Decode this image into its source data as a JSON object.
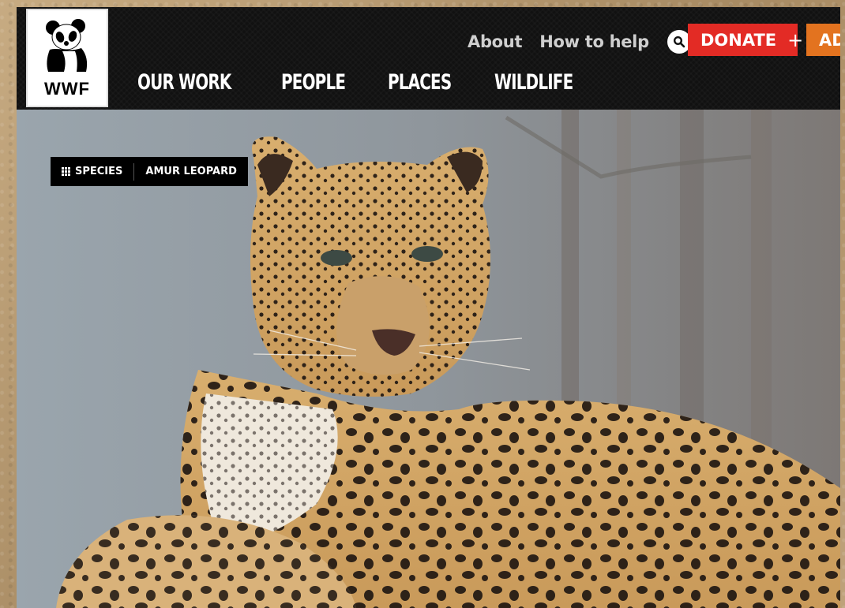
{
  "brand": {
    "logo_text": "WWF"
  },
  "header": {
    "top_links": [
      "About",
      "How to help"
    ],
    "donate_label": "DONATE",
    "donate_plus": "+",
    "adopt_label": "AD",
    "nav": [
      "OUR WORK",
      "PEOPLE",
      "PLACES",
      "WILDLIFE"
    ]
  },
  "breadcrumb": {
    "section": "SPECIES",
    "page": "AMUR LEOPARD"
  },
  "icons": {
    "search": "search-icon",
    "species": "grid-icon",
    "logo": "panda-logo-icon"
  },
  "colors": {
    "donate": "#e32b25",
    "adopt": "#e3731f",
    "header_bg": "#111111"
  }
}
